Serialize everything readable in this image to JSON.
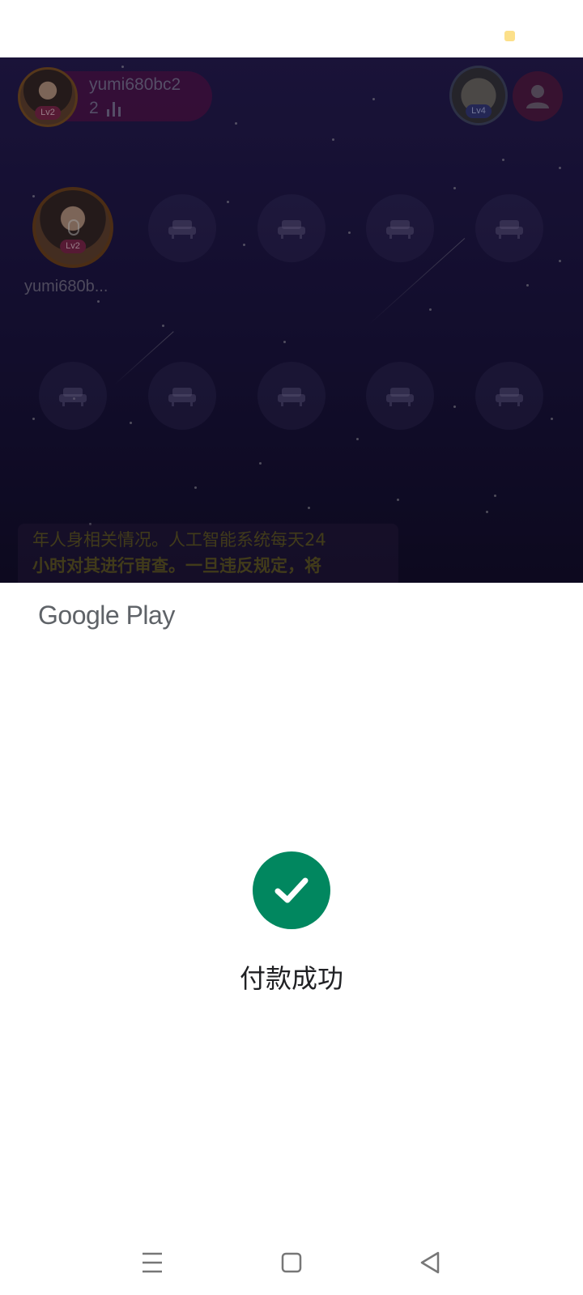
{
  "room": {
    "host": {
      "name": "yumi680bc2",
      "count": "2",
      "level": "Lv2"
    },
    "room_badge_level": "Lv4",
    "seat_user": {
      "name": "yumi680b...",
      "level": "Lv2"
    },
    "notice_line1": "年人身相关情况。人工智能系统每天24",
    "notice_line2": "小时对其进行审查。一旦违反规定，将"
  },
  "sheet": {
    "brand": "Google Play",
    "success_message": "付款成功",
    "accent_color": "#01875f"
  },
  "nav": {
    "recent": "menu-icon",
    "home": "square-icon",
    "back": "back-triangle-icon"
  }
}
